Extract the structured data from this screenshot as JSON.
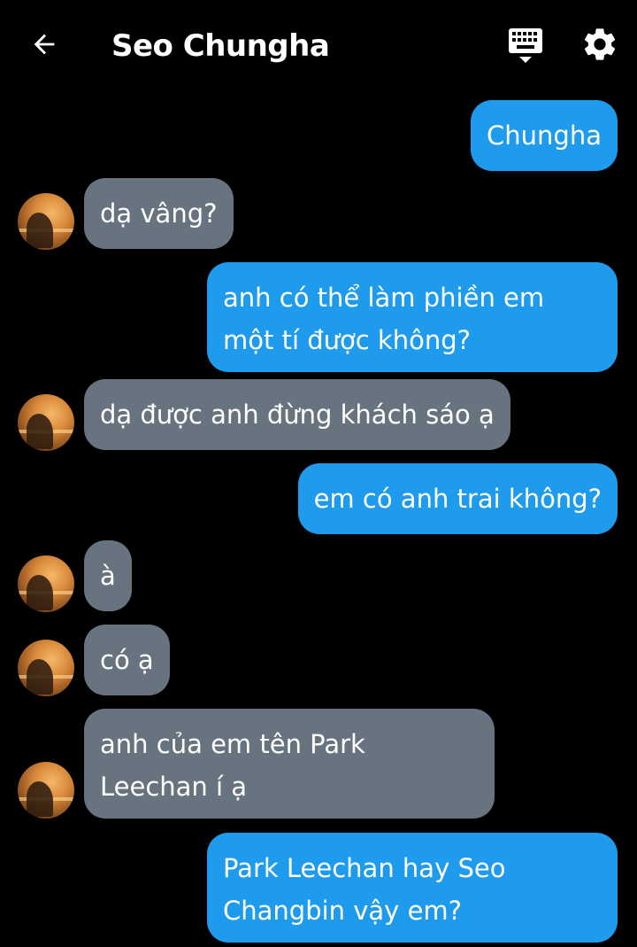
{
  "header": {
    "title": "Seo Chungha",
    "back_icon": "arrow-left-icon",
    "keyboard_icon": "keyboard-icon",
    "settings_icon": "gear-icon"
  },
  "colors": {
    "background": "#000000",
    "outgoing_bubble": "#1e9bec",
    "incoming_bubble": "#67737f",
    "text": "#ffffff"
  },
  "messages": [
    {
      "direction": "outgoing",
      "text": "Chungha"
    },
    {
      "direction": "incoming",
      "text": "dạ vâng?"
    },
    {
      "direction": "outgoing",
      "text": "anh có thể làm phiền em một tí được không?"
    },
    {
      "direction": "incoming",
      "text": "dạ được anh đừng khách sáo ạ"
    },
    {
      "direction": "outgoing",
      "text": "em có anh trai không?"
    },
    {
      "direction": "incoming",
      "text": "à"
    },
    {
      "direction": "incoming",
      "text": "có ạ"
    },
    {
      "direction": "incoming",
      "text": "anh của em tên Park Leechan í ạ"
    },
    {
      "direction": "outgoing",
      "text": "Park Leechan hay Seo Changbin vậy em?"
    }
  ]
}
